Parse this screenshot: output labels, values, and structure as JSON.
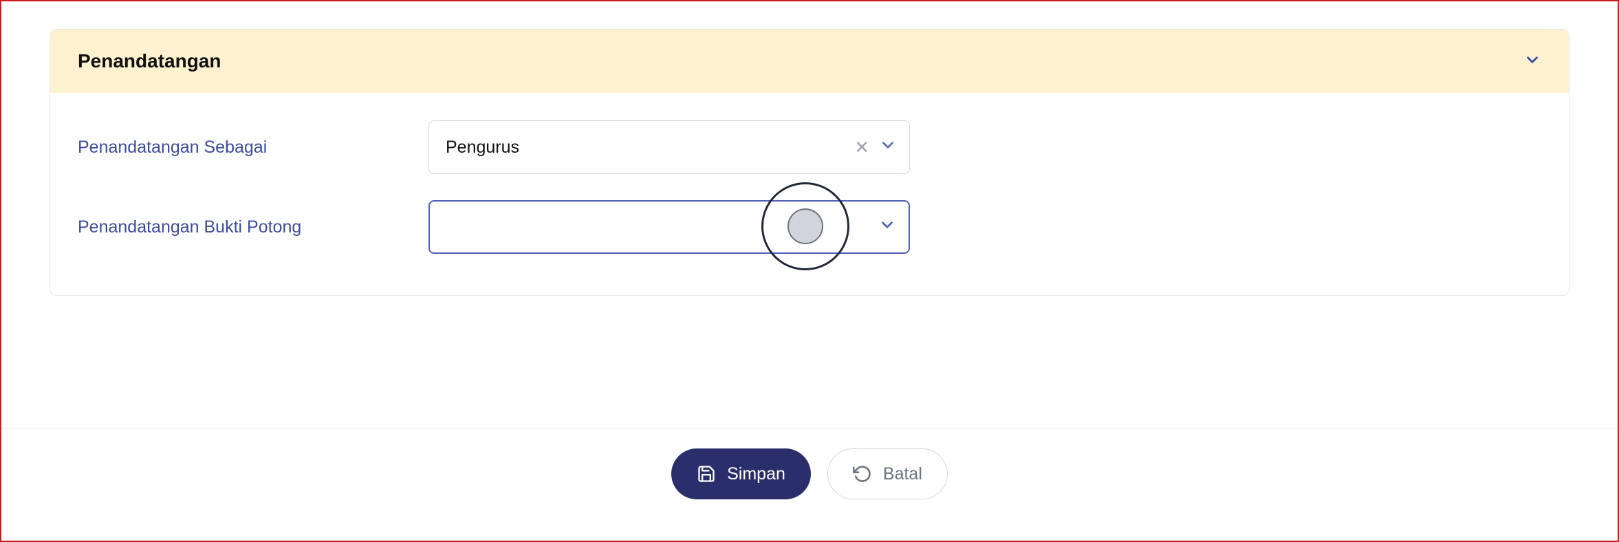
{
  "panel": {
    "title": "Penandatangan"
  },
  "form": {
    "row1": {
      "label": "Penandatangan Sebagai",
      "value": "Pengurus"
    },
    "row2": {
      "label": "Penandatangan Bukti Potong",
      "value": ""
    }
  },
  "footer": {
    "save_label": "Simpan",
    "cancel_label": "Batal"
  }
}
